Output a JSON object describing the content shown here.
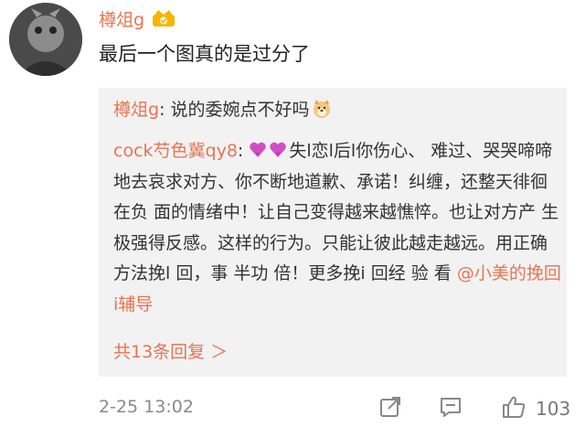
{
  "comment": {
    "username": "樽俎g",
    "text": "最后一个图真的是过分了"
  },
  "replies": {
    "first": {
      "name": "樽俎g",
      "text": ": 说的委婉点不好吗"
    },
    "second": {
      "name": "cock芍色冀qy8",
      "text_part1": "失l恋l后l你伤心、 难过、哭哭啼啼地去哀求对方、你不断地道歉、承诺！纠缠，还整天徘徊在负 面的情绪中！让自己变得越来越憔悴。也让对方产 生极强得反感。这样的行为。只能让彼此越走越远。用正确方法挽l 回，事 半功 倍！更多挽i 回经 验 看 ",
      "mention": "@小美的挽回i辅导"
    },
    "more_label": "共13条回复 ＞"
  },
  "footer": {
    "timestamp": "2-25 13:02",
    "like_count": "103"
  },
  "colors": {
    "accent": "#eb7350",
    "reply_bg": "#f2f2f2",
    "muted": "#8a8a8a"
  },
  "icons": [
    "avatar",
    "vip-crown-icon",
    "heart-icon",
    "dog-emoji-icon",
    "share-icon",
    "comment-icon",
    "like-icon"
  ]
}
